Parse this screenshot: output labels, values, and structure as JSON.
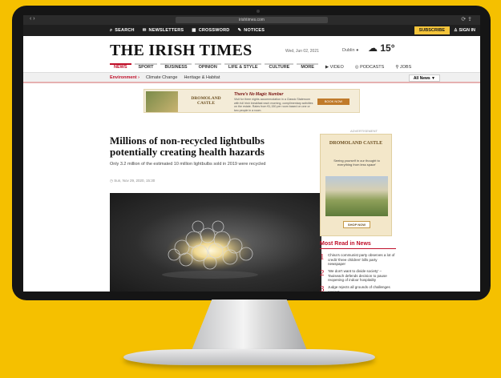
{
  "browser": {
    "url": "irishtimes.com",
    "nav_glyph": "‹ ›",
    "tools_glyph": "⟳ ⇪"
  },
  "topnav": {
    "items": [
      "SEARCH",
      "NEWSLETTERS",
      "CROSSWORD",
      "NOTICES"
    ],
    "subscribe": "SUBSCRIBE",
    "sign_in": "SIGN IN"
  },
  "masthead": {
    "logo": "THE IRISH TIMES",
    "date": "Wed, Jun 02, 2021",
    "location": "Dublin",
    "temperature": "15°"
  },
  "sections": [
    "NEWS",
    "SPORT",
    "BUSINESS",
    "OPINION",
    "LIFE & STYLE",
    "CULTURE",
    "MORE",
    "VIDEO",
    "PODCASTS",
    "JOBS"
  ],
  "subnav": {
    "primary": "Environment",
    "links": [
      "Climate Change",
      "Heritage & Habitat"
    ],
    "all_news": "All News"
  },
  "banner_ad": {
    "brand": "DROMOLAND CASTLE",
    "headline": "There's No Magic Number",
    "copy": "Visit for three nights accommodation in a Classic Stateroom with full Irish breakfast each morning, complimentary activities on the estate. Rates from €1,150 per room based on one or two people in a room.",
    "button": "BOOK NOW"
  },
  "article": {
    "headline": "Millions of non-recycled lightbulbs potentially creating health hazards",
    "standfirst": "Only 3.2 million of the estimated 10 million lightbulbs sold in 2019 were recycled",
    "meta": "Sun, Nov 29, 2020, 15:30"
  },
  "side_ad": {
    "label": "ADVERTISEMENT",
    "brand": "DROMOLAND CASTLE",
    "copy": "Seeing yourself in our thought to everything from less space'",
    "button": "SHOP NOW"
  },
  "most_read": {
    "title": "Most Read in News",
    "items": [
      {
        "n": "1",
        "text": "China's communist party observes a lot of credit 'three children' bills party newspaper"
      },
      {
        "n": "2",
        "text": "'We don't want to divide society' – Taoiseach defends decision to pause reopening of indoor hospitality"
      },
      {
        "n": "3",
        "text": "Judge rejects all grounds of challenges against ..."
      }
    ]
  },
  "colors": {
    "brand_red": "#c0102a",
    "subscribe_yellow": "#f4c43a",
    "background": "#f5c000"
  }
}
